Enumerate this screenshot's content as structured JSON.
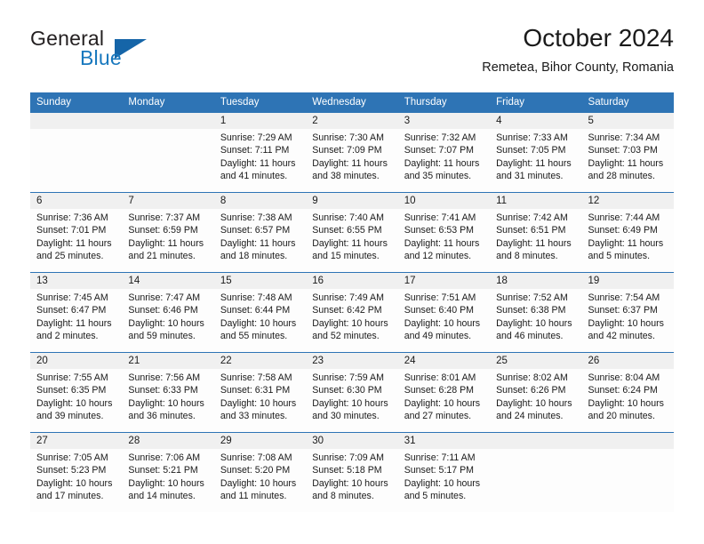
{
  "brand": {
    "line1": "General",
    "line2": "Blue",
    "logo_color": "#1565a8",
    "text_color": "#1878be"
  },
  "header": {
    "title": "October 2024",
    "subtitle": "Remetea, Bihor County, Romania"
  },
  "theme": {
    "header_blue": "#2e74b5",
    "date_band_gray": "#f0f0f0",
    "body_white": "#fdfdfd"
  },
  "weekdays": [
    "Sunday",
    "Monday",
    "Tuesday",
    "Wednesday",
    "Thursday",
    "Friday",
    "Saturday"
  ],
  "weeks": [
    {
      "days": [
        {
          "num": "",
          "sunrise": "",
          "sunset": "",
          "daylight_line1": "",
          "daylight_line2": ""
        },
        {
          "num": "",
          "sunrise": "",
          "sunset": "",
          "daylight_line1": "",
          "daylight_line2": ""
        },
        {
          "num": "1",
          "sunrise": "Sunrise: 7:29 AM",
          "sunset": "Sunset: 7:11 PM",
          "daylight_line1": "Daylight: 11 hours",
          "daylight_line2": "and 41 minutes."
        },
        {
          "num": "2",
          "sunrise": "Sunrise: 7:30 AM",
          "sunset": "Sunset: 7:09 PM",
          "daylight_line1": "Daylight: 11 hours",
          "daylight_line2": "and 38 minutes."
        },
        {
          "num": "3",
          "sunrise": "Sunrise: 7:32 AM",
          "sunset": "Sunset: 7:07 PM",
          "daylight_line1": "Daylight: 11 hours",
          "daylight_line2": "and 35 minutes."
        },
        {
          "num": "4",
          "sunrise": "Sunrise: 7:33 AM",
          "sunset": "Sunset: 7:05 PM",
          "daylight_line1": "Daylight: 11 hours",
          "daylight_line2": "and 31 minutes."
        },
        {
          "num": "5",
          "sunrise": "Sunrise: 7:34 AM",
          "sunset": "Sunset: 7:03 PM",
          "daylight_line1": "Daylight: 11 hours",
          "daylight_line2": "and 28 minutes."
        }
      ]
    },
    {
      "days": [
        {
          "num": "6",
          "sunrise": "Sunrise: 7:36 AM",
          "sunset": "Sunset: 7:01 PM",
          "daylight_line1": "Daylight: 11 hours",
          "daylight_line2": "and 25 minutes."
        },
        {
          "num": "7",
          "sunrise": "Sunrise: 7:37 AM",
          "sunset": "Sunset: 6:59 PM",
          "daylight_line1": "Daylight: 11 hours",
          "daylight_line2": "and 21 minutes."
        },
        {
          "num": "8",
          "sunrise": "Sunrise: 7:38 AM",
          "sunset": "Sunset: 6:57 PM",
          "daylight_line1": "Daylight: 11 hours",
          "daylight_line2": "and 18 minutes."
        },
        {
          "num": "9",
          "sunrise": "Sunrise: 7:40 AM",
          "sunset": "Sunset: 6:55 PM",
          "daylight_line1": "Daylight: 11 hours",
          "daylight_line2": "and 15 minutes."
        },
        {
          "num": "10",
          "sunrise": "Sunrise: 7:41 AM",
          "sunset": "Sunset: 6:53 PM",
          "daylight_line1": "Daylight: 11 hours",
          "daylight_line2": "and 12 minutes."
        },
        {
          "num": "11",
          "sunrise": "Sunrise: 7:42 AM",
          "sunset": "Sunset: 6:51 PM",
          "daylight_line1": "Daylight: 11 hours",
          "daylight_line2": "and 8 minutes."
        },
        {
          "num": "12",
          "sunrise": "Sunrise: 7:44 AM",
          "sunset": "Sunset: 6:49 PM",
          "daylight_line1": "Daylight: 11 hours",
          "daylight_line2": "and 5 minutes."
        }
      ]
    },
    {
      "days": [
        {
          "num": "13",
          "sunrise": "Sunrise: 7:45 AM",
          "sunset": "Sunset: 6:47 PM",
          "daylight_line1": "Daylight: 11 hours",
          "daylight_line2": "and 2 minutes."
        },
        {
          "num": "14",
          "sunrise": "Sunrise: 7:47 AM",
          "sunset": "Sunset: 6:46 PM",
          "daylight_line1": "Daylight: 10 hours",
          "daylight_line2": "and 59 minutes."
        },
        {
          "num": "15",
          "sunrise": "Sunrise: 7:48 AM",
          "sunset": "Sunset: 6:44 PM",
          "daylight_line1": "Daylight: 10 hours",
          "daylight_line2": "and 55 minutes."
        },
        {
          "num": "16",
          "sunrise": "Sunrise: 7:49 AM",
          "sunset": "Sunset: 6:42 PM",
          "daylight_line1": "Daylight: 10 hours",
          "daylight_line2": "and 52 minutes."
        },
        {
          "num": "17",
          "sunrise": "Sunrise: 7:51 AM",
          "sunset": "Sunset: 6:40 PM",
          "daylight_line1": "Daylight: 10 hours",
          "daylight_line2": "and 49 minutes."
        },
        {
          "num": "18",
          "sunrise": "Sunrise: 7:52 AM",
          "sunset": "Sunset: 6:38 PM",
          "daylight_line1": "Daylight: 10 hours",
          "daylight_line2": "and 46 minutes."
        },
        {
          "num": "19",
          "sunrise": "Sunrise: 7:54 AM",
          "sunset": "Sunset: 6:37 PM",
          "daylight_line1": "Daylight: 10 hours",
          "daylight_line2": "and 42 minutes."
        }
      ]
    },
    {
      "days": [
        {
          "num": "20",
          "sunrise": "Sunrise: 7:55 AM",
          "sunset": "Sunset: 6:35 PM",
          "daylight_line1": "Daylight: 10 hours",
          "daylight_line2": "and 39 minutes."
        },
        {
          "num": "21",
          "sunrise": "Sunrise: 7:56 AM",
          "sunset": "Sunset: 6:33 PM",
          "daylight_line1": "Daylight: 10 hours",
          "daylight_line2": "and 36 minutes."
        },
        {
          "num": "22",
          "sunrise": "Sunrise: 7:58 AM",
          "sunset": "Sunset: 6:31 PM",
          "daylight_line1": "Daylight: 10 hours",
          "daylight_line2": "and 33 minutes."
        },
        {
          "num": "23",
          "sunrise": "Sunrise: 7:59 AM",
          "sunset": "Sunset: 6:30 PM",
          "daylight_line1": "Daylight: 10 hours",
          "daylight_line2": "and 30 minutes."
        },
        {
          "num": "24",
          "sunrise": "Sunrise: 8:01 AM",
          "sunset": "Sunset: 6:28 PM",
          "daylight_line1": "Daylight: 10 hours",
          "daylight_line2": "and 27 minutes."
        },
        {
          "num": "25",
          "sunrise": "Sunrise: 8:02 AM",
          "sunset": "Sunset: 6:26 PM",
          "daylight_line1": "Daylight: 10 hours",
          "daylight_line2": "and 24 minutes."
        },
        {
          "num": "26",
          "sunrise": "Sunrise: 8:04 AM",
          "sunset": "Sunset: 6:24 PM",
          "daylight_line1": "Daylight: 10 hours",
          "daylight_line2": "and 20 minutes."
        }
      ]
    },
    {
      "days": [
        {
          "num": "27",
          "sunrise": "Sunrise: 7:05 AM",
          "sunset": "Sunset: 5:23 PM",
          "daylight_line1": "Daylight: 10 hours",
          "daylight_line2": "and 17 minutes."
        },
        {
          "num": "28",
          "sunrise": "Sunrise: 7:06 AM",
          "sunset": "Sunset: 5:21 PM",
          "daylight_line1": "Daylight: 10 hours",
          "daylight_line2": "and 14 minutes."
        },
        {
          "num": "29",
          "sunrise": "Sunrise: 7:08 AM",
          "sunset": "Sunset: 5:20 PM",
          "daylight_line1": "Daylight: 10 hours",
          "daylight_line2": "and 11 minutes."
        },
        {
          "num": "30",
          "sunrise": "Sunrise: 7:09 AM",
          "sunset": "Sunset: 5:18 PM",
          "daylight_line1": "Daylight: 10 hours",
          "daylight_line2": "and 8 minutes."
        },
        {
          "num": "31",
          "sunrise": "Sunrise: 7:11 AM",
          "sunset": "Sunset: 5:17 PM",
          "daylight_line1": "Daylight: 10 hours",
          "daylight_line2": "and 5 minutes."
        },
        {
          "num": "",
          "sunrise": "",
          "sunset": "",
          "daylight_line1": "",
          "daylight_line2": ""
        },
        {
          "num": "",
          "sunrise": "",
          "sunset": "",
          "daylight_line1": "",
          "daylight_line2": ""
        }
      ]
    }
  ]
}
